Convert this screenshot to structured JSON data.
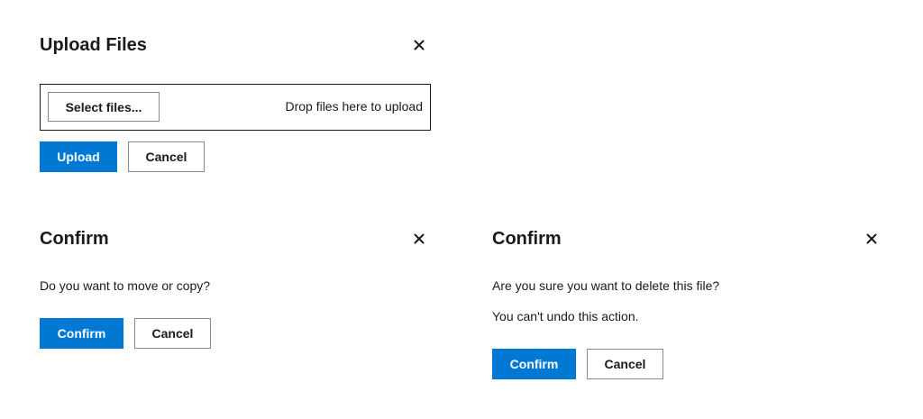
{
  "upload_dialog": {
    "title": "Upload Files",
    "select_files_label": "Select files...",
    "drop_hint": "Drop files here to upload",
    "upload_label": "Upload",
    "cancel_label": "Cancel",
    "close_icon": "close-icon"
  },
  "move_confirm_dialog": {
    "title": "Confirm",
    "message": "Do you want to move or copy?",
    "confirm_label": "Confirm",
    "cancel_label": "Cancel",
    "close_icon": "close-icon"
  },
  "delete_confirm_dialog": {
    "title": "Confirm",
    "message": "Are you sure you want to delete this file?",
    "warning": "You can't undo this action.",
    "confirm_label": "Confirm",
    "cancel_label": "Cancel",
    "close_icon": "close-icon"
  },
  "colors": {
    "primary": "#0078d4",
    "text": "#1a1a1a",
    "border": "#8a8a8a"
  }
}
